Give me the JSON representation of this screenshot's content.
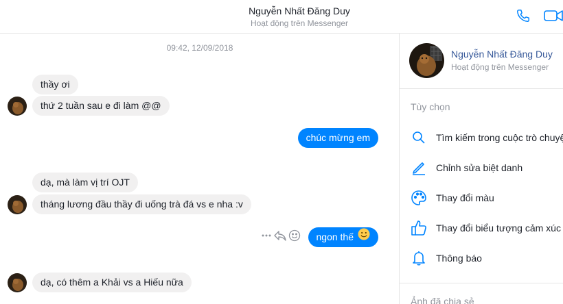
{
  "header": {
    "title": "Nguyễn Nhất Đăng Duy",
    "status": "Hoạt động trên Messenger"
  },
  "conversation": {
    "timestamp": "09:42, 12/09/2018",
    "messages": [
      {
        "side": "in",
        "text": "thầy ơi"
      },
      {
        "side": "in",
        "text": "thứ 2 tuần sau e đi làm @@"
      },
      {
        "side": "out",
        "text": "chúc mừng em"
      },
      {
        "side": "in",
        "text": "dạ, mà làm vị trí OJT"
      },
      {
        "side": "in",
        "text": "tháng lương đầu thầy đi uống trà đá vs e nha :v"
      },
      {
        "side": "out",
        "text": "ngon thế",
        "emoji": "slightly-smiling-face"
      },
      {
        "side": "in",
        "text": "dạ, có thêm a Khải vs a Hiếu nữa"
      }
    ]
  },
  "panel": {
    "name": "Nguyễn Nhất Đăng Duy",
    "status": "Hoạt động trên Messenger",
    "options_title": "Tùy chọn",
    "options": [
      {
        "icon": "search-icon",
        "label": "Tìm kiếm trong cuộc trò chuyện"
      },
      {
        "icon": "pencil-icon",
        "label": "Chỉnh sửa biệt danh"
      },
      {
        "icon": "palette-icon",
        "label": "Thay đổi màu"
      },
      {
        "icon": "thumbs-up-icon",
        "label": "Thay đổi biểu tượng cảm xúc"
      },
      {
        "icon": "bell-icon",
        "label": "Thông báo"
      }
    ],
    "shared_title": "Ảnh đã chia sẻ"
  },
  "colors": {
    "accent": "#0084ff",
    "incoming_bubble": "#f1f0f0",
    "link": "#365899",
    "muted": "#90949c"
  }
}
